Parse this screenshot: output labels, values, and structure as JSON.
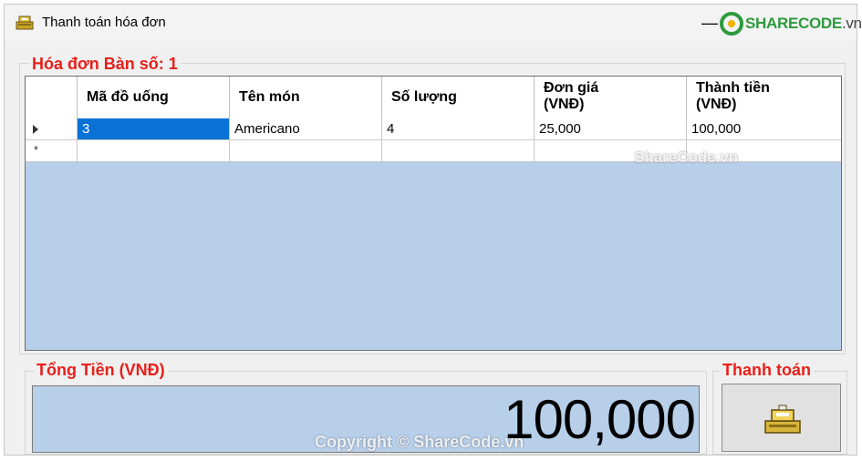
{
  "window": {
    "title": "Thanh toán hóa đơn",
    "minimize": "—",
    "logo": {
      "brand": "SHARECODE",
      "suffix": ".vn"
    }
  },
  "invoice": {
    "legend": "Hóa đơn Bàn số: 1",
    "columns": [
      {
        "line1": "Mã đồ uống",
        "line2": ""
      },
      {
        "line1": "Tên món",
        "line2": ""
      },
      {
        "line1": "Số lượng",
        "line2": ""
      },
      {
        "line1": "Đơn giá",
        "line2": "(VNĐ)"
      },
      {
        "line1": "Thành tiền",
        "line2": "(VNĐ)"
      }
    ],
    "rows": [
      {
        "code": "3",
        "name": "Americano",
        "qty": "4",
        "price": "25,000",
        "amount": "100,000"
      }
    ],
    "new_row_marker": "*"
  },
  "total": {
    "legend": "Tổng Tiền (VNĐ)",
    "value": "100,000"
  },
  "payment": {
    "legend": "Thanh toán",
    "icon": "cash-register-icon"
  },
  "watermarks": {
    "center": "ShareCode.vn",
    "bottom": "Copyright © ShareCode.vn"
  },
  "colors": {
    "legend_red": "#e8201a",
    "grid_background": "#b8cfea",
    "selection_blue": "#0a72d4",
    "brand_green": "#2e9a3e"
  }
}
